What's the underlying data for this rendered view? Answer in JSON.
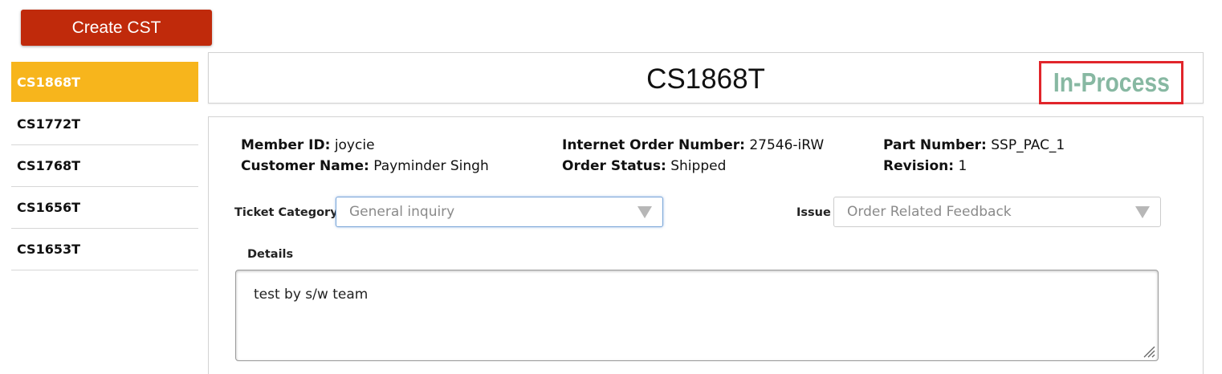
{
  "toolbar": {
    "create_label": "Create CST"
  },
  "sidebar": {
    "items": [
      {
        "label": "CS1868T",
        "active": true
      },
      {
        "label": "CS1772T",
        "active": false
      },
      {
        "label": "CS1768T",
        "active": false
      },
      {
        "label": "CS1656T",
        "active": false
      },
      {
        "label": "CS1653T",
        "active": false
      }
    ]
  },
  "ticket": {
    "id": "CS1868T",
    "status": "In-Process",
    "status_color": "#87b8a2",
    "highlight_color": "#e1252b"
  },
  "info": {
    "member_id_label": "Member ID:",
    "member_id": "joycie",
    "customer_name_label": "Customer Name:",
    "customer_name": "Payminder Singh",
    "order_number_label": "Internet Order Number:",
    "order_number": "27546-iRW",
    "order_status_label": "Order Status:",
    "order_status": "Shipped",
    "part_number_label": "Part Number:",
    "part_number": "SSP_PAC_1",
    "revision_label": "Revision:",
    "revision": "1"
  },
  "form": {
    "category_label": "Ticket Category",
    "category_value": "General inquiry",
    "issue_label": "Issue",
    "issue_value": "Order Related Feedback",
    "details_label": "Details",
    "details_value": "test by s/w team"
  },
  "colors": {
    "create_button": "#c02a0b",
    "active_item": "#f7b51c"
  }
}
